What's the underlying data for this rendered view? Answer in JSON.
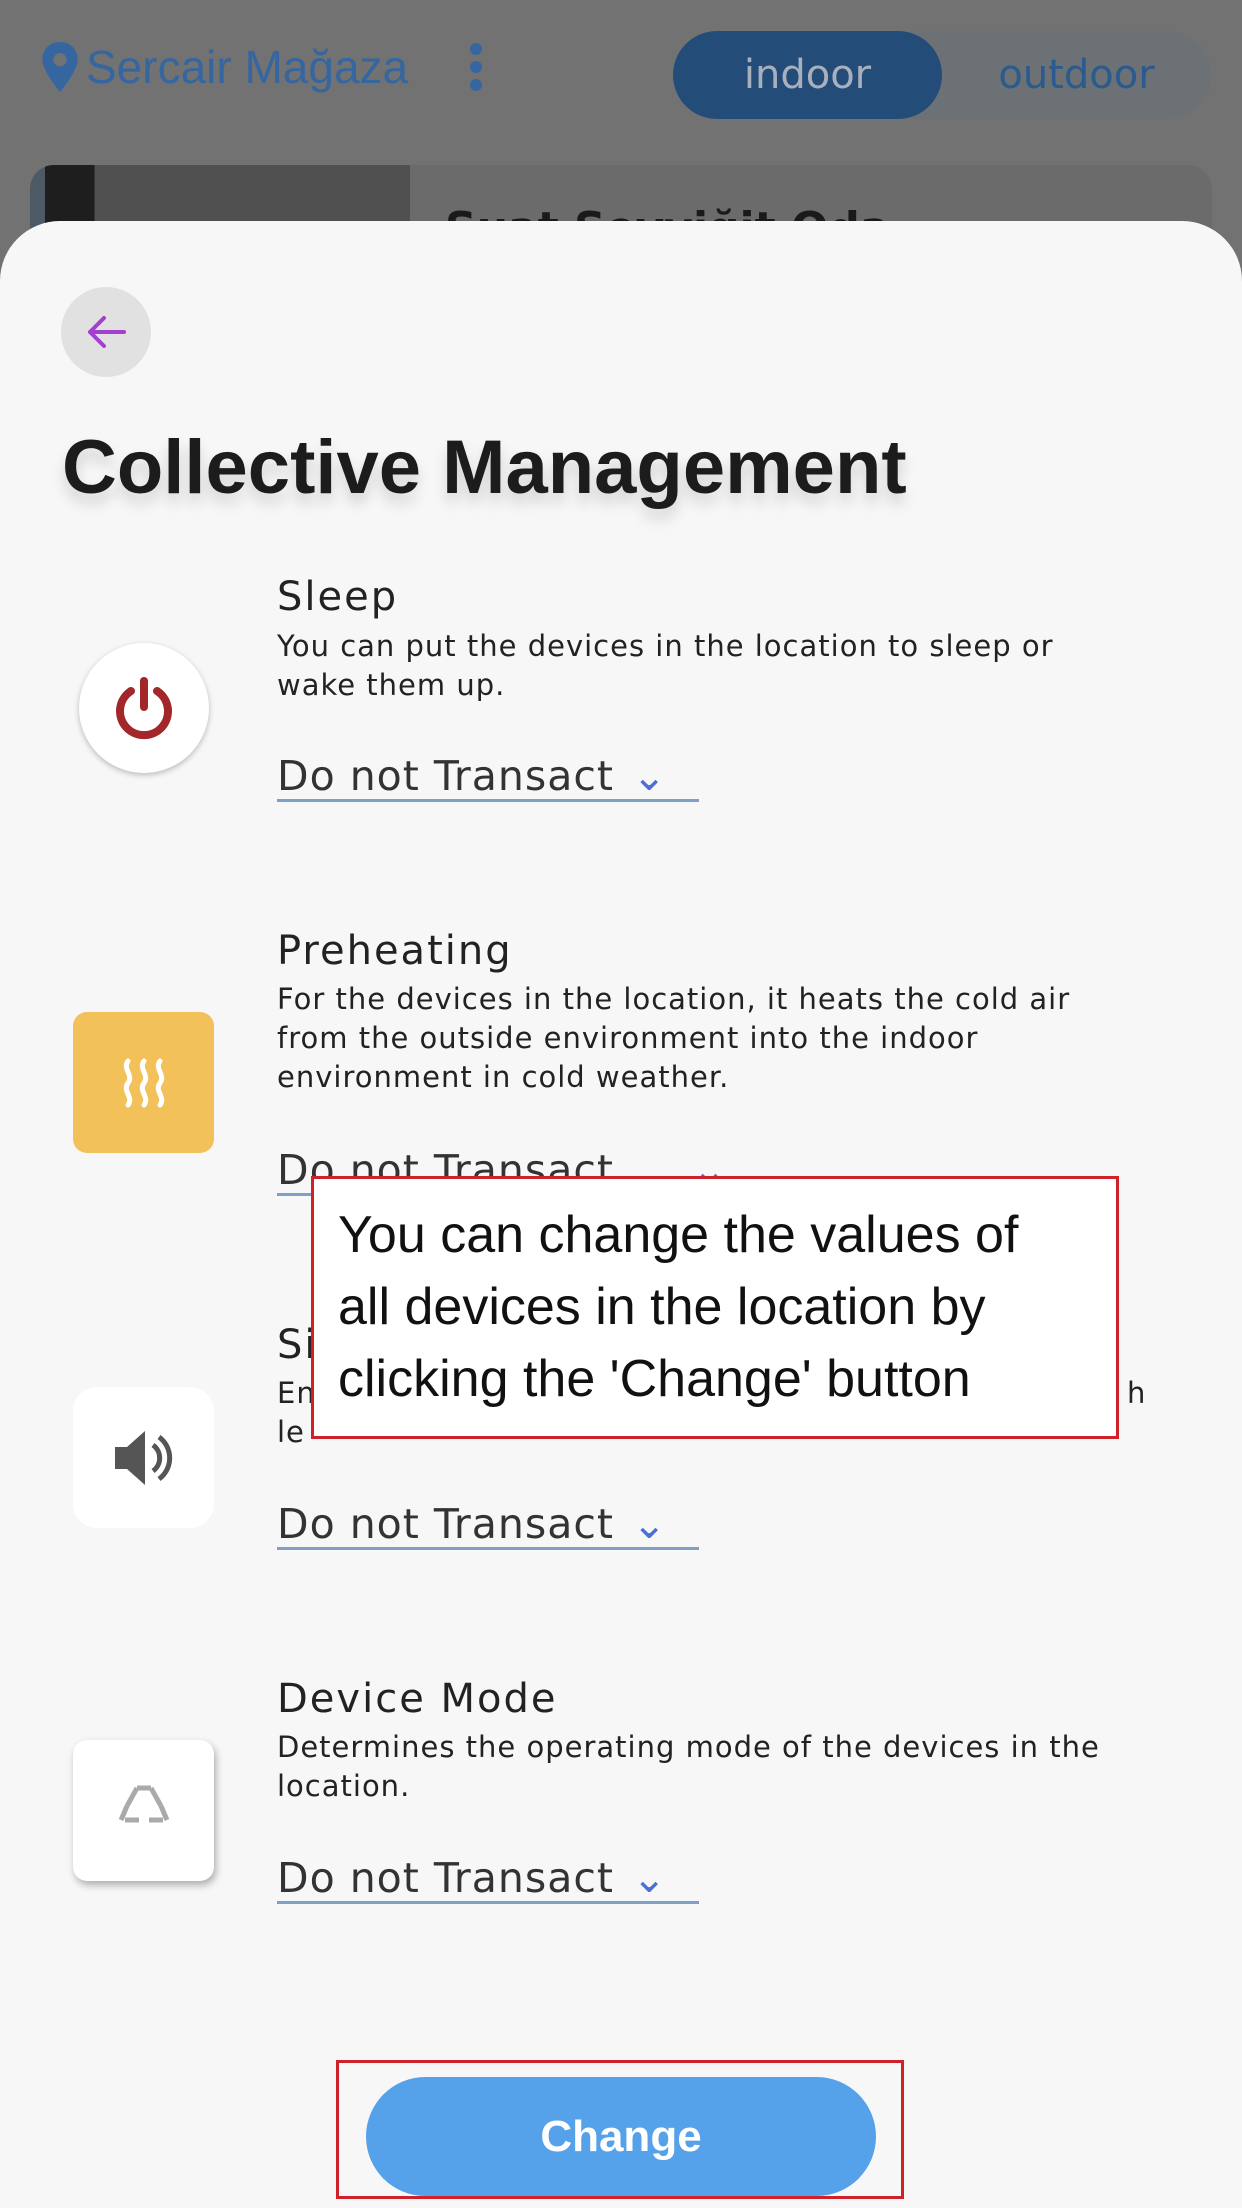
{
  "header": {
    "location": "Sercair Mağaza",
    "toggle": [
      "indoor",
      "outdoor"
    ],
    "card_title": "Suat Sevyiğit Oda"
  },
  "sheet": {
    "title": "Collective Management",
    "sections": [
      {
        "title": "Sleep",
        "desc": [
          "You can put the devices in the location to sleep or",
          "wake them up."
        ],
        "value": "Do not Transact",
        "icon": "power-icon"
      },
      {
        "title": "Preheating",
        "desc": [
          "For the devices in the location, it heats the cold air",
          "from the outside environment into the indoor",
          "environment in cold weather."
        ],
        "value": "Do not Transact",
        "icon": "heat-icon"
      },
      {
        "title": "Si",
        "desc": [
          "En",
          "le"
        ],
        "desc_tail": "h",
        "value": "Do not Transact",
        "icon": "speaker-icon"
      },
      {
        "title": "Device Mode",
        "desc": [
          "Determines the operating mode of the devices in the",
          "location."
        ],
        "value": "Do not Transact",
        "icon": "recycle-icon"
      }
    ],
    "button": "Change"
  },
  "tooltip": [
    "You can change the values of",
    "all devices in the location by",
    "clicking the 'Change' button"
  ],
  "colors": {
    "accent": "#2f6fb4",
    "button": "#55a1ea",
    "annotation": "#d0202a",
    "heat": "#f3c15a"
  }
}
